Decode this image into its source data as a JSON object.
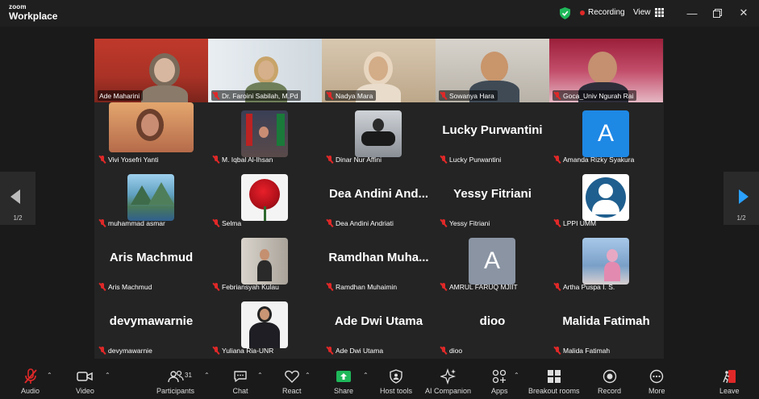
{
  "app": {
    "logo_top": "zoom",
    "logo_bottom": "Workplace"
  },
  "status": {
    "recording": "Recording",
    "view": "View"
  },
  "window_controls": [
    "minimize-icon",
    "restore-icon",
    "close-icon"
  ],
  "navigation": {
    "page": "1/2",
    "right_page": "1/2"
  },
  "participants": [
    {
      "name": "Ade Maharini",
      "display": "video",
      "active": true
    },
    {
      "name": "Dr. Faroini Sabilah, M.Pd",
      "display": "video"
    },
    {
      "name": "Nadya Mara",
      "display": "video"
    },
    {
      "name": "Sowanya Hara",
      "display": "video"
    },
    {
      "name": "Goca_Univ Ngurah Rai",
      "display": "video"
    },
    {
      "name": "Vivi Yosefri Yanti",
      "display": "photo"
    },
    {
      "name": "M. Iqbal Al-Ihsan",
      "display": "photo"
    },
    {
      "name": "Dinar Nur Affini",
      "display": "photo"
    },
    {
      "name": "Lucky Purwantini",
      "display": "name",
      "big": "Lucky Purwantini"
    },
    {
      "name": "Amanda Rizky Syakura",
      "display": "letter",
      "letter": "A"
    },
    {
      "name": "muhammad asmar",
      "display": "photo"
    },
    {
      "name": "Selma",
      "display": "photo"
    },
    {
      "name": "Dea Andini Andriati",
      "display": "name",
      "big": "Dea Andini And..."
    },
    {
      "name": "Yessy Fitriani",
      "display": "name",
      "big": "Yessy Fitriani"
    },
    {
      "name": "LPPI UMM",
      "display": "avatar"
    },
    {
      "name": "Aris Machmud",
      "display": "name",
      "big": "Aris Machmud"
    },
    {
      "name": "Febriansyah Kulau",
      "display": "photo"
    },
    {
      "name": "Ramdhan Muhaimin",
      "display": "name",
      "big": "Ramdhan Muha..."
    },
    {
      "name": "AMRUL FARUQ MJIIT",
      "display": "letter",
      "letter": "A"
    },
    {
      "name": "Artha Puspa I. S.",
      "display": "photo"
    },
    {
      "name": "devymawarnie",
      "display": "name",
      "big": "devymawarnie"
    },
    {
      "name": "Yuliana Ria-UNR",
      "display": "photo"
    },
    {
      "name": "Ade Dwi Utama",
      "display": "name",
      "big": "Ade Dwi Utama"
    },
    {
      "name": "dioo",
      "display": "name",
      "big": "dioo"
    },
    {
      "name": "Malida Fatimah",
      "display": "name",
      "big": "Malida Fatimah"
    }
  ],
  "toolbar": {
    "audio": "Audio",
    "video": "Video",
    "participants": "Participants",
    "participant_count": "31",
    "chat": "Chat",
    "react": "React",
    "share": "Share",
    "host_tools": "Host tools",
    "ai_companion": "AI Companion",
    "apps": "Apps",
    "breakout_rooms": "Breakout rooms",
    "record": "Record",
    "more": "More",
    "leave": "Leave"
  },
  "colors": {
    "accent_green": "#22c55e",
    "recording_red": "#e02828",
    "share_green": "#1fb85a",
    "letter_blue": "#1e88e5",
    "letter_gray": "#8a94a3",
    "leave_red": "#e02828"
  }
}
